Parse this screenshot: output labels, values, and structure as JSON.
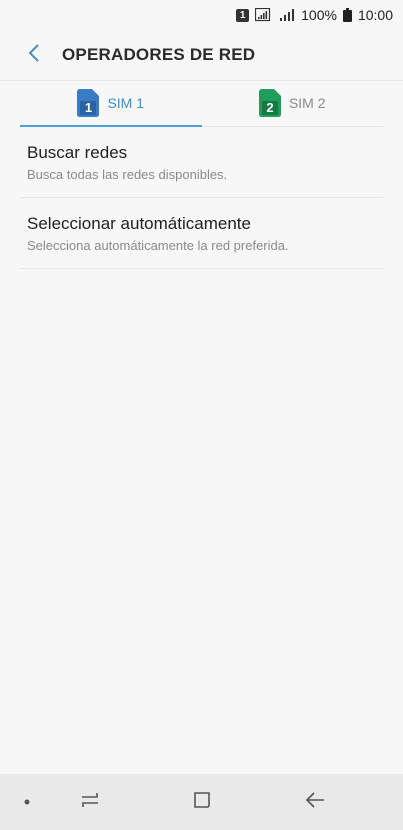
{
  "status_bar": {
    "sim_badge": "1",
    "battery": "100%",
    "time": "10:00"
  },
  "header": {
    "title": "OPERADORES DE RED",
    "back_icon": "chevron-left-icon"
  },
  "tabs": [
    {
      "label": "SIM 1",
      "sim_number": "1",
      "color": "#3a7cc4",
      "active": true
    },
    {
      "label": "SIM 2",
      "sim_number": "2",
      "color": "#1f9d5a",
      "active": false
    }
  ],
  "items": [
    {
      "title": "Buscar redes",
      "subtitle": "Busca todas las redes disponibles."
    },
    {
      "title": "Seleccionar automáticamente",
      "subtitle": "Selecciona automáticamente la red preferida."
    }
  ],
  "colors": {
    "accent": "#4fa1d3",
    "background": "#f7f7f7"
  },
  "nav_bar": {
    "icons": [
      "dot-icon",
      "recents-icon",
      "home-icon",
      "back-arrow-icon"
    ]
  }
}
